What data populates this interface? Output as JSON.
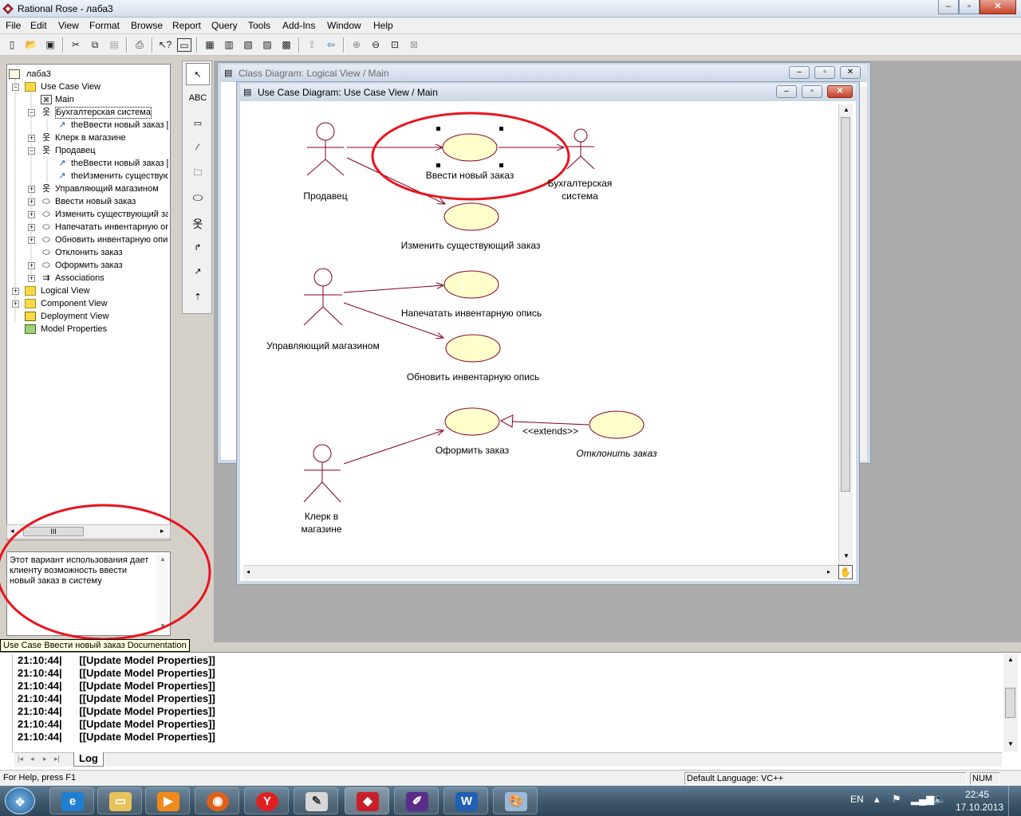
{
  "window": {
    "title": "Rational Rose - лаба3",
    "caption_buttons": [
      "minimize",
      "maximize",
      "close"
    ]
  },
  "menu": [
    "File",
    "Edit",
    "View",
    "Format",
    "Browse",
    "Report",
    "Query",
    "Tools",
    "Add-Ins",
    "Window",
    "Help"
  ],
  "toolbar_icons": [
    "new-icon",
    "open-icon",
    "save-icon",
    "cut-icon",
    "copy-icon",
    "paste-icon",
    "print-icon",
    "context-help-icon",
    "view-documentation-icon",
    "browse-class-diagram-icon",
    "browse-interaction-diagram-icon",
    "browse-component-diagram-icon",
    "browse-deployment-diagram-icon",
    "browse-parent-icon",
    "browse-previous-icon",
    "zoom-in-icon",
    "zoom-out-icon",
    "fit-in-window-icon",
    "undo-fit-icon"
  ],
  "tree": {
    "root": "лаба3",
    "items": [
      {
        "label": "Use Case View",
        "icon": "folder-icon"
      },
      {
        "label": "Main",
        "icon": "diagram-icon"
      },
      {
        "label": "Бухгалтерская система",
        "icon": "actor-icon"
      },
      {
        "label": "theВвести новый заказ [",
        "icon": "association-icon"
      },
      {
        "label": "Клерк в магазине",
        "icon": "actor-icon"
      },
      {
        "label": "Продавец",
        "icon": "actor-icon"
      },
      {
        "label": "theВвести новый заказ [",
        "icon": "association-icon"
      },
      {
        "label": "theИзменить существую",
        "icon": "association-icon"
      },
      {
        "label": "Управляющий магазином",
        "icon": "actor-icon"
      },
      {
        "label": "Ввести новый заказ",
        "icon": "usecase-icon"
      },
      {
        "label": "Изменить существующий за",
        "icon": "usecase-icon"
      },
      {
        "label": "Напечатать инвентарную оп",
        "icon": "usecase-icon"
      },
      {
        "label": "Обновить инвентарную опис",
        "icon": "usecase-icon"
      },
      {
        "label": "Отклонить заказ",
        "icon": "usecase-icon"
      },
      {
        "label": "Оформить заказ",
        "icon": "usecase-icon"
      },
      {
        "label": "Associations",
        "icon": "associations-icon"
      },
      {
        "label": "Logical View",
        "icon": "folder-icon"
      },
      {
        "label": "Component View",
        "icon": "folder-icon"
      },
      {
        "label": "Deployment View",
        "icon": "deployment-icon"
      },
      {
        "label": "Model Properties",
        "icon": "properties-icon"
      }
    ],
    "scroll_glyph": "III"
  },
  "documentation": {
    "text": "Этот вариант использования дает клиенту возможность ввести новый заказ в систему",
    "tooltip": "Use Case Ввести новый заказ Documentation"
  },
  "toolbox": {
    "text_tool": "ABC",
    "tools": [
      "selection-tool-icon",
      "text-box-icon",
      "note-icon",
      "anchor-note-icon",
      "package-icon",
      "use-case-icon",
      "actor-icon",
      "unidirectional-association-icon",
      "dependency-icon",
      "generalization-icon"
    ]
  },
  "windows": {
    "class_diagram": "Class Diagram: Logical View / Main",
    "use_case_diagram": "Use Case Diagram: Use Case View / Main"
  },
  "diagram": {
    "actors": {
      "seller": "Продавец",
      "accounting_1": "Бухгалтерская",
      "accounting_2": "система",
      "manager": "Управляющий магазином",
      "clerk_1": "Клерк в",
      "clerk_2": "магазине"
    },
    "use_cases": {
      "new_order": "Ввести новый заказ",
      "change_order": "Изменить существующий заказ",
      "print_inventory": "Напечатать инвентарную опись",
      "update_inventory": "Обновить инвентарную опись",
      "place_order": "Оформить заказ",
      "reject_order": "Отклонить заказ"
    },
    "stereotype": "<<extends>>",
    "colors": {
      "usecase_fill": "#ffffcc",
      "line": "#800020",
      "highlight": "#e8141e"
    }
  },
  "log": {
    "lines": [
      {
        "time": "21:10:44|",
        "msg": "[[Update Model Properties]]"
      },
      {
        "time": "21:10:44|",
        "msg": "[[Update Model Properties]]"
      },
      {
        "time": "21:10:44|",
        "msg": "[[Update Model Properties]]"
      },
      {
        "time": "21:10:44|",
        "msg": "[[Update Model Properties]]"
      },
      {
        "time": "21:10:44|",
        "msg": "[[Update Model Properties]]"
      },
      {
        "time": "21:10:44|",
        "msg": "[[Update Model Properties]]"
      },
      {
        "time": "21:10:44|",
        "msg": "[[Update Model Properties]]"
      }
    ],
    "tab": "Log"
  },
  "status": {
    "help": "For Help, press F1",
    "language": "Default Language: VC++",
    "num": "NUM"
  },
  "taskbar": {
    "apps": [
      "internet-explorer",
      "explorer",
      "media-player",
      "firefox",
      "yandex",
      "app-6",
      "rational-rose",
      "app-8",
      "word",
      "paint"
    ],
    "lang": "EN",
    "time": "22:45",
    "date": "17.10.2013"
  }
}
